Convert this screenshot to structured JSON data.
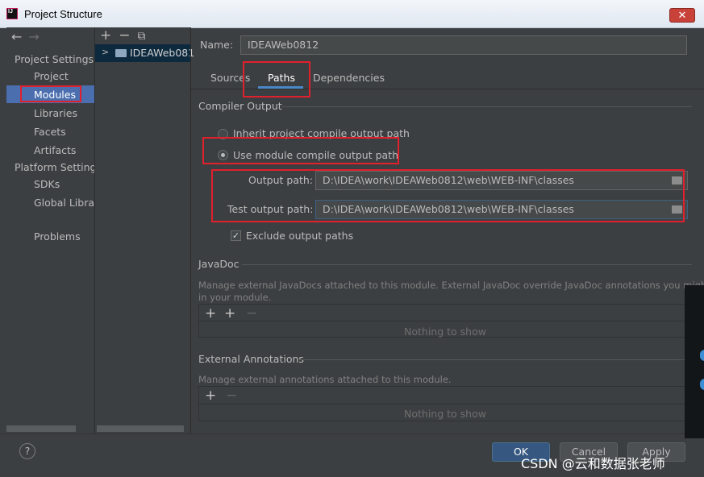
{
  "window": {
    "title": "Project Structure",
    "close_label": "✕"
  },
  "nav": {
    "back": "←",
    "forward": "→"
  },
  "sidebar": {
    "project_settings_header": "Project Settings",
    "items": [
      {
        "label": "Project"
      },
      {
        "label": "Modules"
      },
      {
        "label": "Libraries"
      },
      {
        "label": "Facets"
      },
      {
        "label": "Artifacts"
      }
    ],
    "platform_settings_header": "Platform Settings",
    "platform_items": [
      {
        "label": "SDKs"
      },
      {
        "label": "Global Librar"
      }
    ],
    "problems_label": "Problems",
    "selected": "Modules"
  },
  "modules_list": {
    "tools": {
      "add": "+",
      "remove": "−",
      "copy": "⧉"
    },
    "items": [
      {
        "label": "IDEAWeb081"
      }
    ]
  },
  "module": {
    "name_label": "Name:",
    "name_value": "IDEAWeb0812"
  },
  "tabs": [
    {
      "label": "Sources"
    },
    {
      "label": "Paths"
    },
    {
      "label": "Dependencies"
    }
  ],
  "active_tab": "Paths",
  "compiler_output": {
    "header": "Compiler Output",
    "inherit_label": "Inherit project compile output path",
    "use_module_label": "Use module compile output path",
    "selected_option": "Use module compile output path",
    "output_path_label": "Output path:",
    "output_path_value": "D:\\IDEA\\work\\IDEAWeb0812\\web\\WEB-INF\\classes",
    "test_output_path_label": "Test output path:",
    "test_output_path_value": "D:\\IDEA\\work\\IDEAWeb0812\\web\\WEB-INF\\classes",
    "exclude_label": "Exclude output paths",
    "exclude_checked": true,
    "exclude_mark": "✓"
  },
  "javadoc": {
    "header": "JavaDoc",
    "description": "Manage external JavaDocs attached to this module. External JavaDoc override JavaDoc annotations you might have",
    "description2": "in your module.",
    "tools": {
      "add": "+",
      "add_url": "+",
      "remove": "−"
    },
    "empty_text": "Nothing to show"
  },
  "external_annotations": {
    "header": "External Annotations",
    "description": "Manage external annotations attached to this module.",
    "tools": {
      "add": "+",
      "remove": "−"
    },
    "empty_text": "Nothing to show"
  },
  "footer": {
    "help_label": "?",
    "ok_label": "OK",
    "cancel_label": "Cancel",
    "apply_label": "Apply"
  },
  "watermark": "CSDN @云和数据张老师",
  "colors": {
    "background": "#3c3f41",
    "selection": "#4b6eaf",
    "accent_tab": "#4a88c7",
    "primary_button": "#365880",
    "annotation_box": "#e0202d"
  }
}
